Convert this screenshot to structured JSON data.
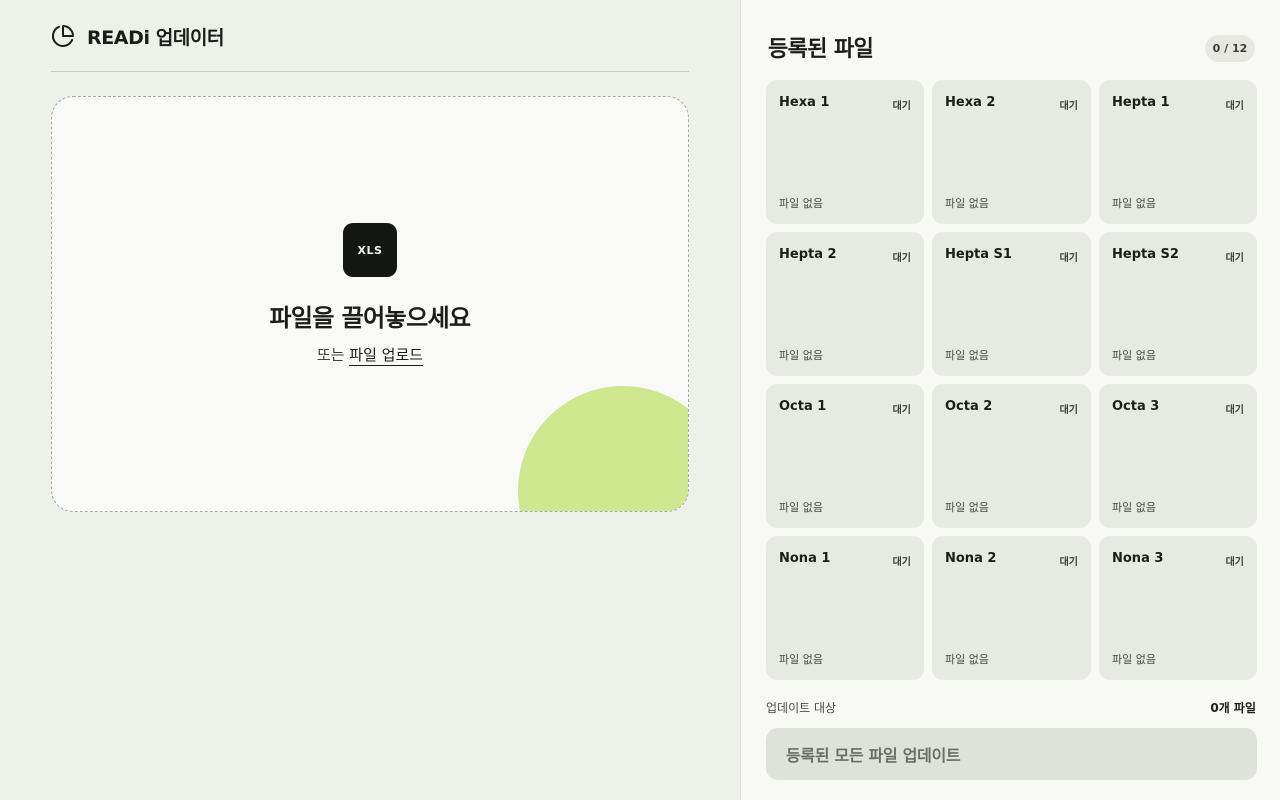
{
  "app": {
    "title": "READi 업데이터",
    "logo_icon": "pie-chart-icon"
  },
  "dropzone": {
    "badge": "XLS",
    "badge_icon": "xls-file-icon",
    "title": "파일을 끌어놓으세요",
    "or_text": "또는",
    "upload_link": "파일 업로드",
    "accent_color": "#cfe890"
  },
  "registered": {
    "title": "등록된 파일",
    "count": "0 / 12",
    "slots": [
      {
        "name": "Hexa 1",
        "status": "대기",
        "file": "파일 없음"
      },
      {
        "name": "Hexa 2",
        "status": "대기",
        "file": "파일 없음"
      },
      {
        "name": "Hepta 1",
        "status": "대기",
        "file": "파일 없음"
      },
      {
        "name": "Hepta 2",
        "status": "대기",
        "file": "파일 없음"
      },
      {
        "name": "Hepta S1",
        "status": "대기",
        "file": "파일 없음"
      },
      {
        "name": "Hepta S2",
        "status": "대기",
        "file": "파일 없음"
      },
      {
        "name": "Octa 1",
        "status": "대기",
        "file": "파일 없음"
      },
      {
        "name": "Octa 2",
        "status": "대기",
        "file": "파일 없음"
      },
      {
        "name": "Octa 3",
        "status": "대기",
        "file": "파일 없음"
      },
      {
        "name": "Nona 1",
        "status": "대기",
        "file": "파일 없음"
      },
      {
        "name": "Nona 2",
        "status": "대기",
        "file": "파일 없음"
      },
      {
        "name": "Nona 3",
        "status": "대기",
        "file": "파일 없음"
      }
    ]
  },
  "footer": {
    "target_label": "업데이트 대상",
    "target_count": "0개 파일",
    "update_button": "등록된 모든 파일 업데이트"
  }
}
